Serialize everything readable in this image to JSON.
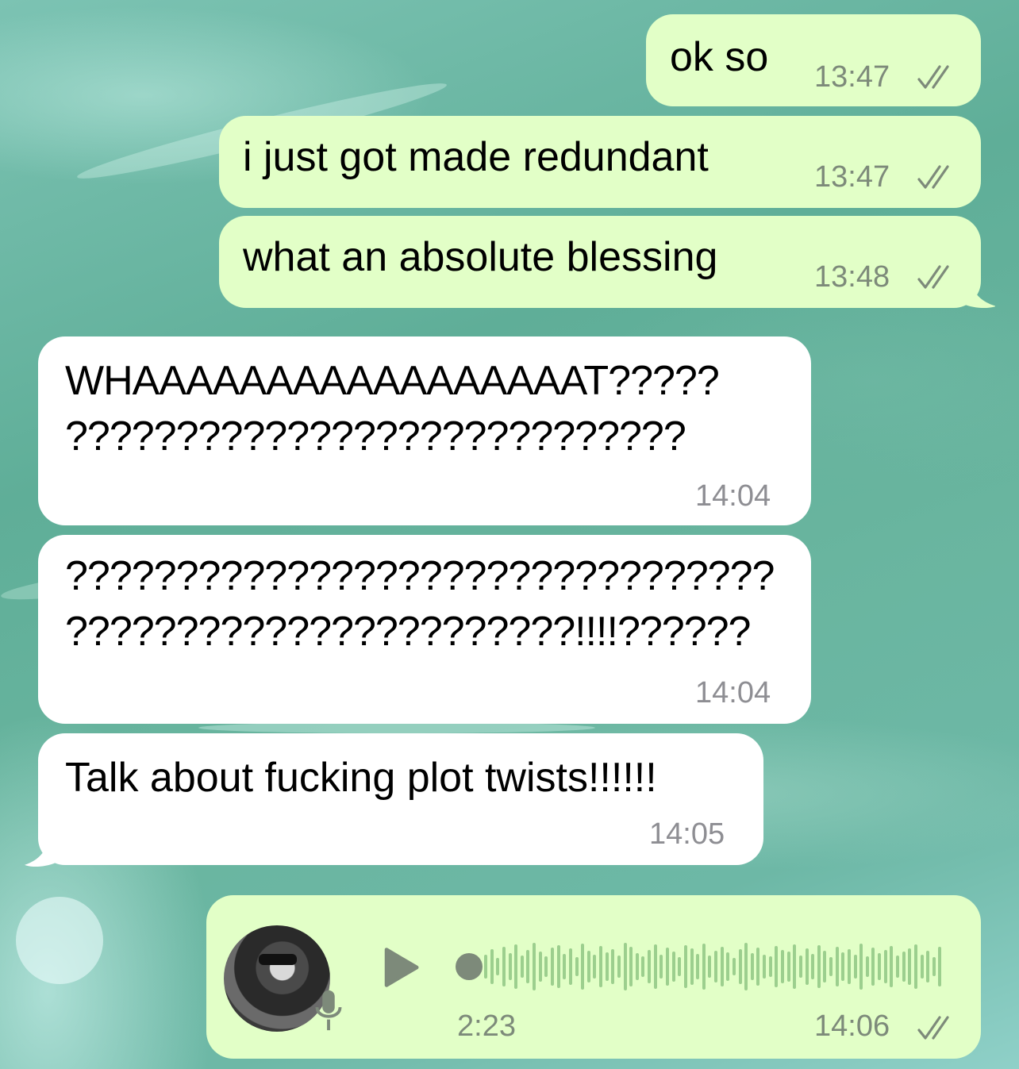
{
  "colors": {
    "outgoing_bubble": "#e2ffc7",
    "incoming_bubble": "#ffffff",
    "timestamp_out": "#7d8a7a",
    "timestamp_in": "#8e8e93",
    "read_ticks": "#7d8a7a",
    "waveform": "#9ccf8e",
    "play_icon": "#7d8a7a"
  },
  "messages": [
    {
      "direction": "outgoing",
      "text": "ok so",
      "time": "13:47",
      "status": "read"
    },
    {
      "direction": "outgoing",
      "text": "i just got made redundant",
      "time": "13:47",
      "status": "read"
    },
    {
      "direction": "outgoing",
      "text": "what an absolute blessing",
      "time": "13:48",
      "status": "read"
    },
    {
      "direction": "incoming",
      "text_line1": "WHAAAAAAAAAAAAAAAAAT?????",
      "text_line2": "????????????????????????????",
      "time": "14:04"
    },
    {
      "direction": "incoming",
      "text_line1": "????????????????????????????????",
      "text_line2": "???????????????????????!!!!??????",
      "time": "14:04"
    },
    {
      "direction": "incoming",
      "text": "Talk about fucking plot twists!!!!!!",
      "time": "14:05"
    }
  ],
  "voice_message": {
    "direction": "outgoing",
    "duration": "2:23",
    "time": "14:06",
    "status": "read",
    "icons": [
      "avatar",
      "microphone-icon",
      "play-icon",
      "waveform"
    ],
    "progress": 0
  }
}
